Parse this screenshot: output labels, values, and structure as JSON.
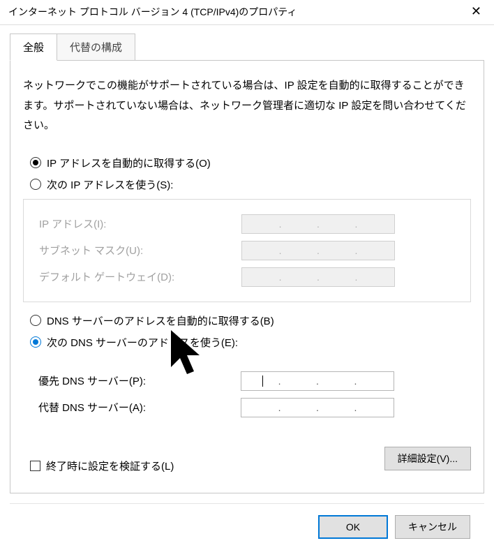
{
  "window": {
    "title": "インターネット プロトコル バージョン 4 (TCP/IPv4)のプロパティ"
  },
  "tabs": {
    "general": "全般",
    "alternate": "代替の構成"
  },
  "description": "ネットワークでこの機能がサポートされている場合は、IP 設定を自動的に取得することができます。サポートされていない場合は、ネットワーク管理者に適切な IP 設定を問い合わせてください。",
  "ip": {
    "auto_label": "IP アドレスを自動的に取得する(O)",
    "manual_label": "次の IP アドレスを使う(S):",
    "ip_label": "IP アドレス(I):",
    "subnet_label": "サブネット マスク(U):",
    "gateway_label": "デフォルト ゲートウェイ(D):",
    "ip_value": [
      "",
      "",
      "",
      ""
    ],
    "subnet_value": [
      "",
      "",
      "",
      ""
    ],
    "gateway_value": [
      "",
      "",
      "",
      ""
    ]
  },
  "dns": {
    "auto_label": "DNS サーバーのアドレスを自動的に取得する(B)",
    "manual_label": "次の DNS サーバーのアドレスを使う(E):",
    "preferred_label": "優先 DNS サーバー(P):",
    "alternate_label": "代替 DNS サーバー(A):",
    "preferred_value": [
      "",
      "",
      "",
      ""
    ],
    "alternate_value": [
      "",
      "",
      "",
      ""
    ]
  },
  "validate_label": "終了時に設定を検証する(L)",
  "advanced_label": "詳細設定(V)...",
  "buttons": {
    "ok": "OK",
    "cancel": "キャンセル"
  }
}
